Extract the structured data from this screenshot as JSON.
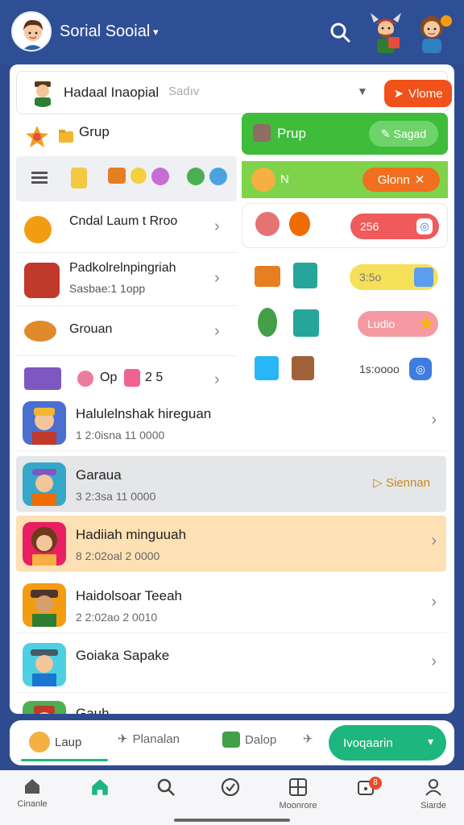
{
  "header": {
    "title": "Sorial Sooial",
    "caret": "▾"
  },
  "topbar": {
    "title": "Hadaal Inaopial",
    "select_value": "Sadıv",
    "button_label": "Vlome"
  },
  "left": {
    "grup_label": "Grup",
    "rows": [
      {
        "title": "Cndal Laum t Rroo",
        "subtitle": ""
      },
      {
        "title": "Padkolrelnpingriah",
        "subtitle": "Sasbae:1 1opp"
      },
      {
        "title": "Grouan",
        "subtitle": ""
      },
      {
        "title": "Op",
        "subtitle": "2 5"
      }
    ]
  },
  "right": {
    "green_label": "Prup",
    "green_button": "Sagad",
    "lime_label": "N",
    "lime_button": "Glonn",
    "pills": [
      "256",
      "3:5o",
      "Ludio",
      "1s:oooo"
    ],
    "colors": {
      "red": "#f05a5a",
      "yellow": "#f5e05a",
      "pink": "#f59aa2"
    }
  },
  "list": [
    {
      "name": "Halulelnshak hireguan",
      "sub": "1 2:0isna 11 0000"
    },
    {
      "name": "Garaua",
      "sub": "3 2:3sa 11 0000",
      "action": "Siennan"
    },
    {
      "name": "Hadiiah minguuah",
      "sub": "8 2:02oal 2 0000"
    },
    {
      "name": "Haidolsoar Teeah",
      "sub": "2 2:02ao 2 0010"
    },
    {
      "name": "Goiaka Sapake",
      "sub": ""
    },
    {
      "name": "Gauh",
      "sub": ""
    }
  ],
  "tabs": {
    "t1": "Laup",
    "t2": "Planalan",
    "t3": "Dalop",
    "green": "Ivoqaarin"
  },
  "nav": [
    "Cinanle",
    "",
    "",
    "",
    "Moonrore",
    "",
    "Siarde"
  ],
  "nav_badge": "8",
  "accent": "#1db67e"
}
